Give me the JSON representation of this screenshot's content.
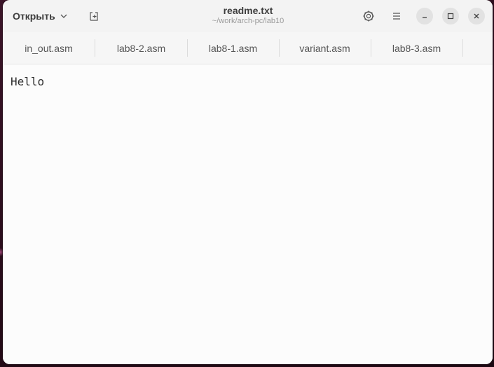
{
  "header": {
    "open_label": "Открыть",
    "title": "readme.txt",
    "subtitle": "~/work/arch-pc/lab10",
    "icons": [
      "chevron-down-icon",
      "new-tab-icon",
      "settings-icon",
      "menu-icon",
      "minimize-icon",
      "maximize-icon",
      "close-icon"
    ]
  },
  "tabs": [
    {
      "label": "in_out.asm"
    },
    {
      "label": "lab8-2.asm"
    },
    {
      "label": "lab8-1.asm"
    },
    {
      "label": "variant.asm"
    },
    {
      "label": "lab8-3.asm"
    }
  ],
  "editor": {
    "content": "Hello"
  },
  "colors": {
    "window_bg": "#fafafa",
    "headerbar_bg": "#f3f3f3",
    "desktop_bg": "#2a0f1c"
  }
}
